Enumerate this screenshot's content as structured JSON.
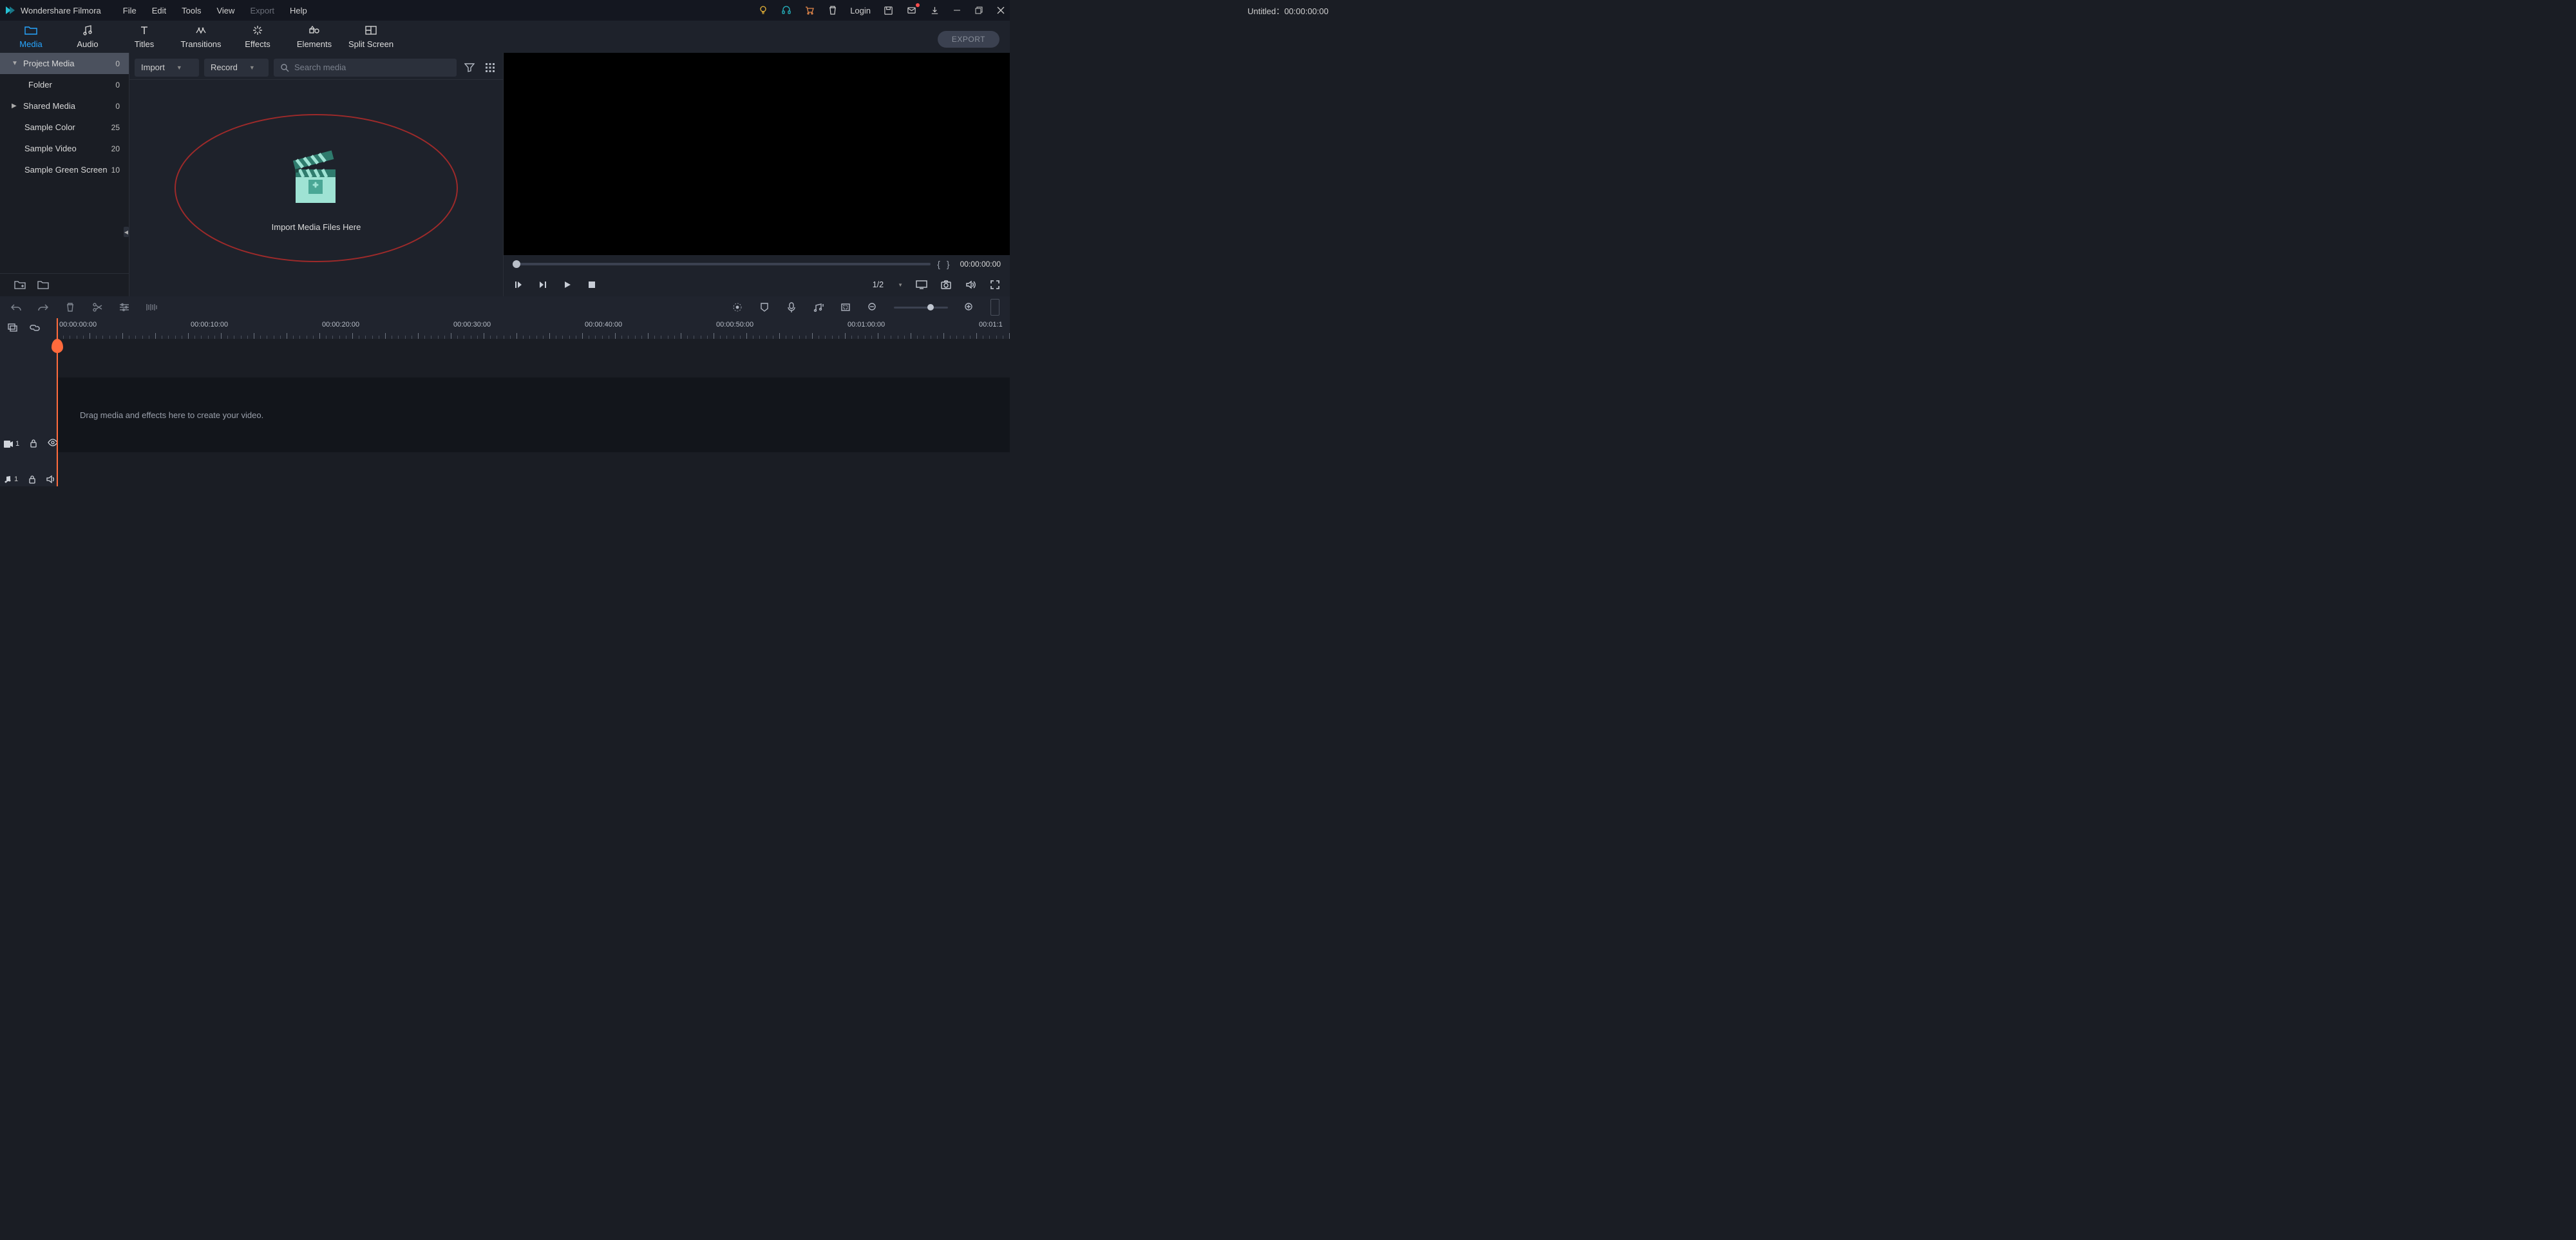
{
  "brand": "Wondershare Filmora",
  "menus": [
    "File",
    "Edit",
    "Tools",
    "View",
    "Export",
    "Help"
  ],
  "menus_disabled_index": 4,
  "doc_title": "Untitled：00:00:00:00",
  "login_label": "Login",
  "tabs": [
    {
      "label": "Media",
      "active": true
    },
    {
      "label": "Audio"
    },
    {
      "label": "Titles"
    },
    {
      "label": "Transitions"
    },
    {
      "label": "Effects"
    },
    {
      "label": "Elements"
    },
    {
      "label": "Split Screen"
    }
  ],
  "export_label": "EXPORT",
  "sidebar": {
    "items": [
      {
        "label": "Project Media",
        "count": 0,
        "arrow": "down",
        "selected": true
      },
      {
        "label": "Folder",
        "count": 0,
        "indent": true
      },
      {
        "label": "Shared Media",
        "count": 0,
        "arrow": "right"
      },
      {
        "label": "Sample Color",
        "count": 25
      },
      {
        "label": "Sample Video",
        "count": 20
      },
      {
        "label": "Sample Green Screen",
        "count": 10
      }
    ]
  },
  "media_toolbar": {
    "import_label": "Import",
    "record_label": "Record",
    "search_placeholder": "Search media"
  },
  "dropzone_label": "Import Media Files Here",
  "preview": {
    "mark_in": "{",
    "mark_out": "}",
    "timecode": "00:00:00:00",
    "ratio": "1/2"
  },
  "timeline": {
    "marks": [
      "00:00:00:00",
      "00:00:10:00",
      "00:00:20:00",
      "00:00:30:00",
      "00:00:40:00",
      "00:00:50:00",
      "00:01:00:00",
      "00:01:1"
    ],
    "hint": "Drag media and effects here to create your video.",
    "video_track_index": "1",
    "audio_track_index": "1"
  }
}
